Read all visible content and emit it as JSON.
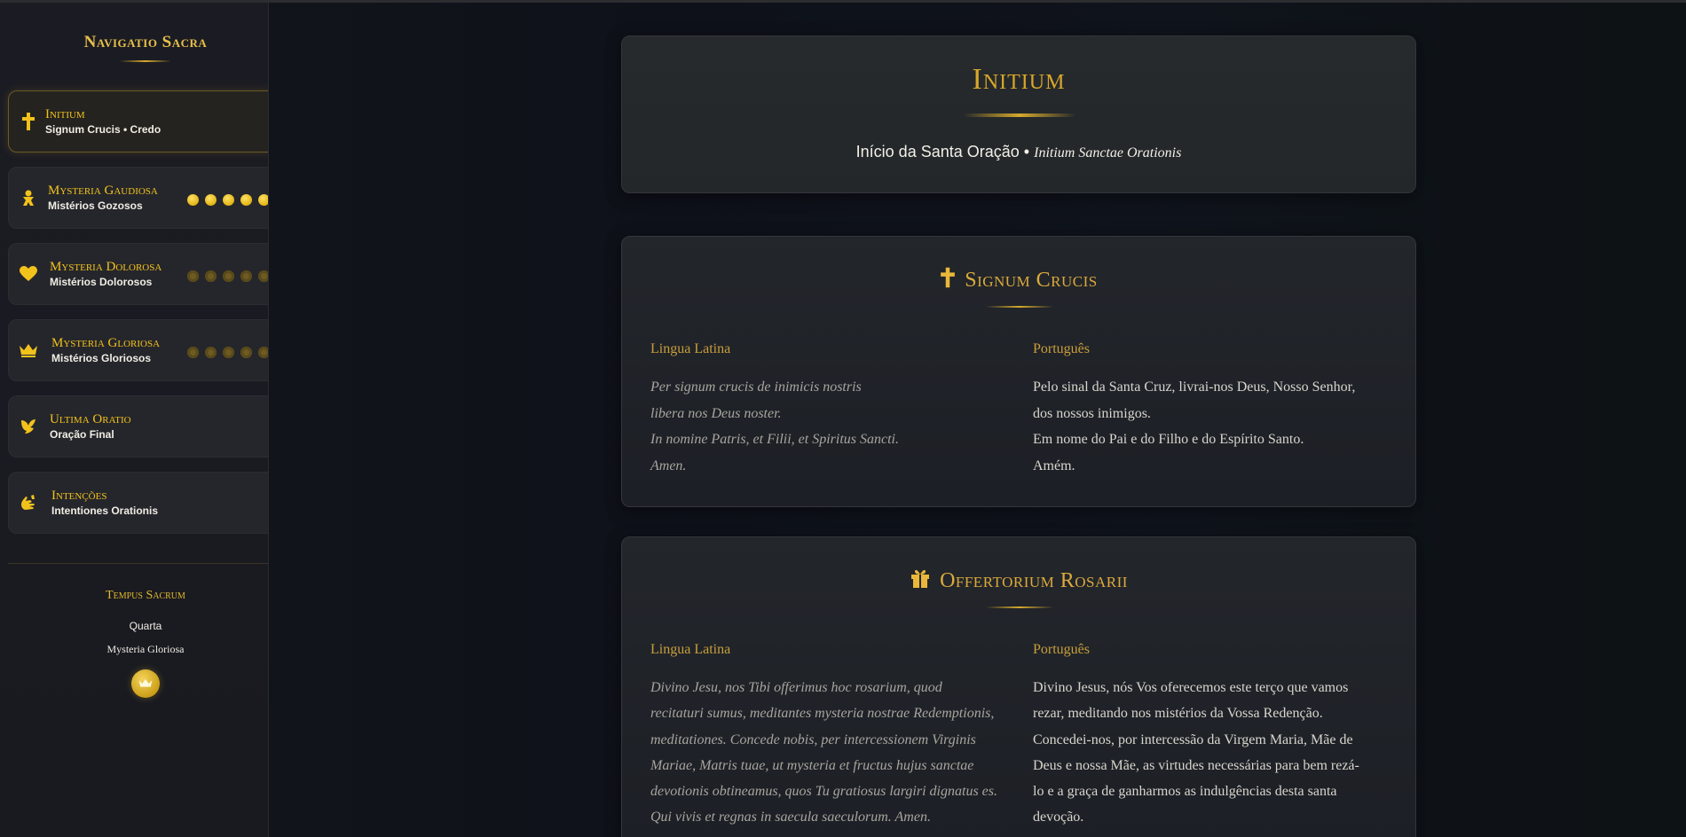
{
  "sidebar": {
    "title": "Navigatio Sacra",
    "items": [
      {
        "title": "Initium",
        "subtitle": "Signum Crucis • Credo",
        "icon": "cross-icon"
      },
      {
        "title": "Mysteria Gaudiosa",
        "subtitle": "Mistérios Gozosos",
        "icon": "baby-icon"
      },
      {
        "title": "Mysteria Dolorosa",
        "subtitle": "Mistérios Dolorosos",
        "icon": "heart-icon"
      },
      {
        "title": "Mysteria Gloriosa",
        "subtitle": "Mistérios Gloriosos",
        "icon": "crown-icon"
      },
      {
        "title": "Ultima Oratio",
        "subtitle": "Oração Final",
        "icon": "dove-icon"
      },
      {
        "title": "Intenções",
        "subtitle": "Intentiones Orationis",
        "icon": "praying-hands-icon"
      }
    ],
    "tempus": {
      "title": "Tempus Sacrum",
      "day": "Quarta",
      "mystery": "Mysteria Gloriosa",
      "badge_icon": "crown-icon"
    }
  },
  "hero": {
    "title": "Initium",
    "subtitle_pt": "Início da Santa Oração",
    "separator": "•",
    "subtitle_latin": "Initium Sanctae Orationis"
  },
  "sections": [
    {
      "title": "Signum Crucis",
      "icon": "cross-icon",
      "latin_label": "Lingua Latina",
      "pt_label": "Português",
      "latin_lines": [
        "Per signum crucis de inimicis nostris",
        "libera nos Deus noster.",
        "In nomine Patris, et Filii, et Spiritus Sancti.",
        "Amen."
      ],
      "pt_lines": [
        "Pelo sinal da Santa Cruz, livrai-nos Deus, Nosso Senhor,",
        "dos nossos inimigos.",
        "Em nome do Pai e do Filho e do Espírito Santo.",
        "Amém."
      ]
    },
    {
      "title": "Offertorium Rosarii",
      "icon": "gift-icon",
      "latin_label": "Lingua Latina",
      "pt_label": "Português",
      "latin_lines": [
        "Divino Jesu, nos Tibi offerimus hoc rosarium, quod",
        "recitaturi sumus, meditantes mysteria nostrae Redemptionis,",
        "meditationes. Concede nobis, per intercessionem Virginis",
        "Mariae, Matris tuae, ut mysteria et fructus hujus sanctae",
        "devotionis obtineamus, quos Tu gratiosus largiri dignatus es.",
        "Qui vivis et regnas in saecula saeculorum. Amen."
      ],
      "pt_lines": [
        "Divino Jesus, nós Vos oferecemos este terço que vamos",
        "rezar, meditando nos mistérios da Vossa Redenção.",
        "Concedei-nos, por intercessão da Virgem Maria, Mãe de",
        "Deus e nossa Mãe, as virtudes necessárias para bem rezá-",
        "lo e a graça de ganharmos as indulgências desta santa",
        "devoção."
      ]
    }
  ],
  "colors": {
    "gold": "#f2c21c",
    "gold_muted": "#dcaa3c",
    "background": "#0f131b",
    "card": "#23262b"
  }
}
